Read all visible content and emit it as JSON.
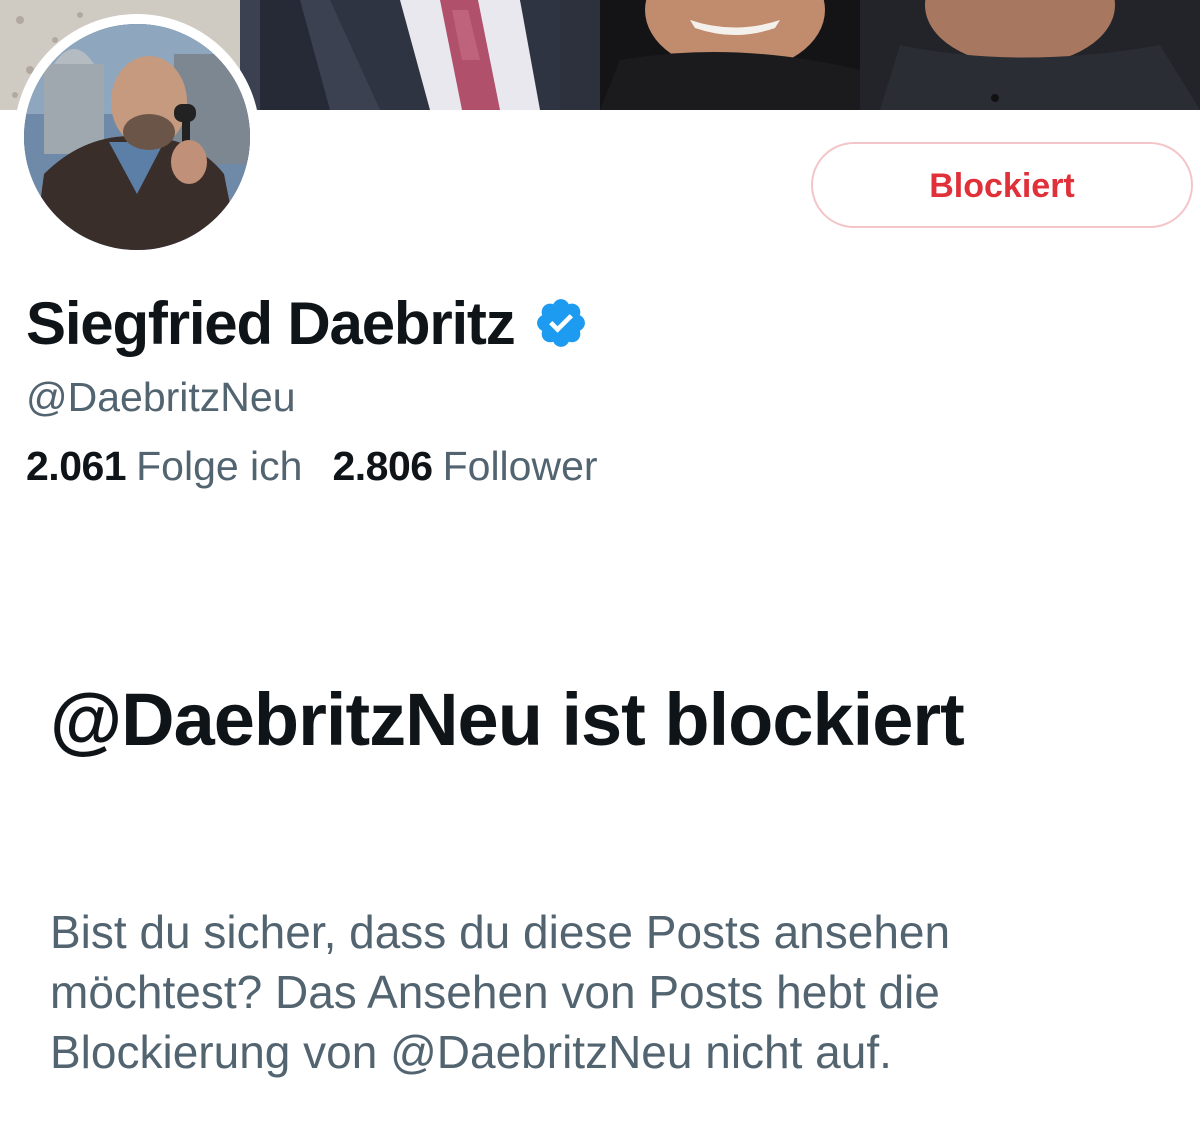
{
  "colors": {
    "text_primary": "#0f1419",
    "text_secondary": "#536471",
    "blocked_red": "#e0303a",
    "blocked_border": "#f4c5c8",
    "verified_blue": "#1d9bf0"
  },
  "header": {
    "banner_image": "banner-photo",
    "avatar_image": "profile-photo"
  },
  "actions": {
    "blocked_label": "Blockiert"
  },
  "profile": {
    "name": "Siegfried Daebritz",
    "verified_icon": "verified-badge-icon",
    "handle": "@DaebritzNeu",
    "following_count": "2.061",
    "following_label": "Folge ich",
    "followers_count": "2.806",
    "followers_label": "Follower"
  },
  "blocked_notice": {
    "title": "@DaebritzNeu ist blockiert",
    "description": "Bist du sicher, dass du diese Posts ansehen möchtest? Das Ansehen von Posts hebt die Blockierung von @DaebritzNeu nicht auf."
  }
}
